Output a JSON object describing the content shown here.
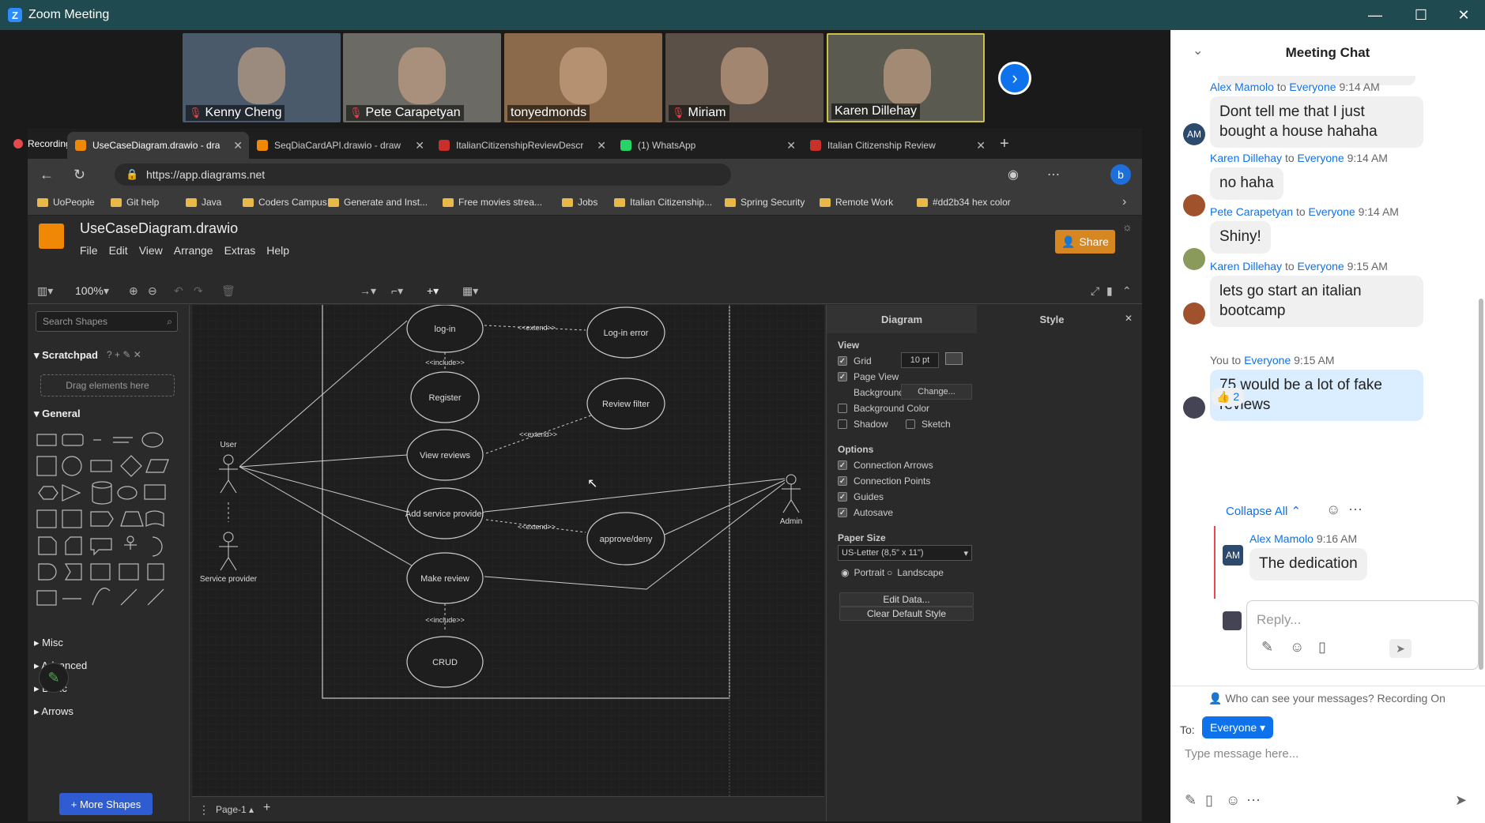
{
  "window": {
    "title": "Zoom Meeting",
    "minimize": "—",
    "maximize": "☐",
    "close": "✕"
  },
  "participants": [
    {
      "name": "Kenny Cheng",
      "muted": true,
      "bg": "#4a5a6a"
    },
    {
      "name": "Pete Carapetyan",
      "muted": true,
      "bg": "#6b6a64"
    },
    {
      "name": "tonyedmonds",
      "muted": false,
      "bg": "#8a6a4a"
    },
    {
      "name": "Miriam",
      "muted": true,
      "bg": "#5a5048"
    },
    {
      "name": "Karen Dillehay",
      "muted": false,
      "bg": "#5a5a50"
    }
  ],
  "next_icon": "›",
  "browser": {
    "recording": "Recording",
    "tabs": [
      {
        "label": "UseCaseDiagram.drawio - dra",
        "fav": "#f08705"
      },
      {
        "label": "SeqDiaCardAPI.drawio - draw",
        "fav": "#f08705"
      },
      {
        "label": "ItalianCitizenshipReviewDescr",
        "fav": "#c9302c"
      },
      {
        "label": "(1) WhatsApp",
        "fav": "#25d366"
      },
      {
        "label": "Italian Citizenship Review",
        "fav": "#c9302c"
      }
    ],
    "new_tab": "+",
    "url": "https://app.diagrams.net",
    "bookmarks": [
      "UoPeople",
      "Git help",
      "Java",
      "Coders Campus",
      "Generate and Inst...",
      "Free movies strea...",
      "Jobs",
      "Italian Citizenship...",
      "Spring Security",
      "Remote Work",
      "#dd2b34 hex color"
    ]
  },
  "drawio": {
    "file": "UseCaseDiagram.drawio",
    "menu": [
      "File",
      "Edit",
      "View",
      "Arrange",
      "Extras",
      "Help"
    ],
    "share": "Share",
    "zoom": "100%",
    "search_placeholder": "Search Shapes",
    "scratchpad": "Scratchpad",
    "scratch_hint": "Drag elements here",
    "general": "General",
    "sections": [
      "Misc",
      "Advanced",
      "Basic",
      "Arrows"
    ],
    "more_shapes": "+ More Shapes",
    "page": "Page-1",
    "diagram": {
      "actors": [
        "User",
        "Service provider",
        "Admin"
      ],
      "usecases": [
        "log-in",
        "Register",
        "View reviews",
        "Add service provider",
        "Make review",
        "CRUD",
        "Log-in error",
        "Review filter",
        "approve/deny"
      ],
      "extend": "<<extend>>",
      "include": "<<include>>"
    },
    "format": {
      "tab_diagram": "Diagram",
      "tab_style": "Style",
      "view": "View",
      "grid": "Grid",
      "grid_size": "10 pt",
      "page_view": "Page View",
      "background": "Background",
      "change": "Change...",
      "background_color": "Background Color",
      "shadow": "Shadow",
      "sketch": "Sketch",
      "options": "Options",
      "connection_arrows": "Connection Arrows",
      "connection_points": "Connection Points",
      "guides": "Guides",
      "autosave": "Autosave",
      "paper_size": "Paper Size",
      "paper": "US-Letter (8,5\" x 11\")",
      "portrait": "Portrait",
      "landscape": "Landscape",
      "edit_data": "Edit Data...",
      "clear_style": "Clear Default Style"
    }
  },
  "chat": {
    "title": "Meeting Chat",
    "messages": [
      {
        "sender": "Alex Mamolo",
        "to": "to",
        "target": "Everyone",
        "time": "9:14 AM",
        "text": "Dont tell me that I just bought a house hahaha",
        "avatar": "AM"
      },
      {
        "sender": "Karen Dillehay",
        "to": "to",
        "target": "Everyone",
        "time": "9:14 AM",
        "text": "no haha",
        "avatar": ""
      },
      {
        "sender": "Pete Carapetyan",
        "to": "to",
        "target": "Everyone",
        "time": "9:14 AM",
        "text": "Shiny!",
        "avatar": ""
      },
      {
        "sender": "Karen Dillehay",
        "to": "to",
        "target": "Everyone",
        "time": "9:15 AM",
        "text": "lets go start an italian bootcamp",
        "avatar": ""
      },
      {
        "sender": "You",
        "to": "to",
        "target": "Everyone",
        "time": "9:15 AM",
        "text": "75 would be a lot of fake reviews",
        "avatar": ""
      }
    ],
    "reaction": "👍 2",
    "collapse": "Collapse All",
    "thread": {
      "sender": "Alex Mamolo",
      "time": "9:16 AM",
      "text": "The dedication",
      "avatar": "AM"
    },
    "reply_placeholder": "Reply...",
    "visibility": "Who can see your messages? Recording On",
    "to_label": "To:",
    "to_value": "Everyone",
    "input_placeholder": "Type message here..."
  }
}
